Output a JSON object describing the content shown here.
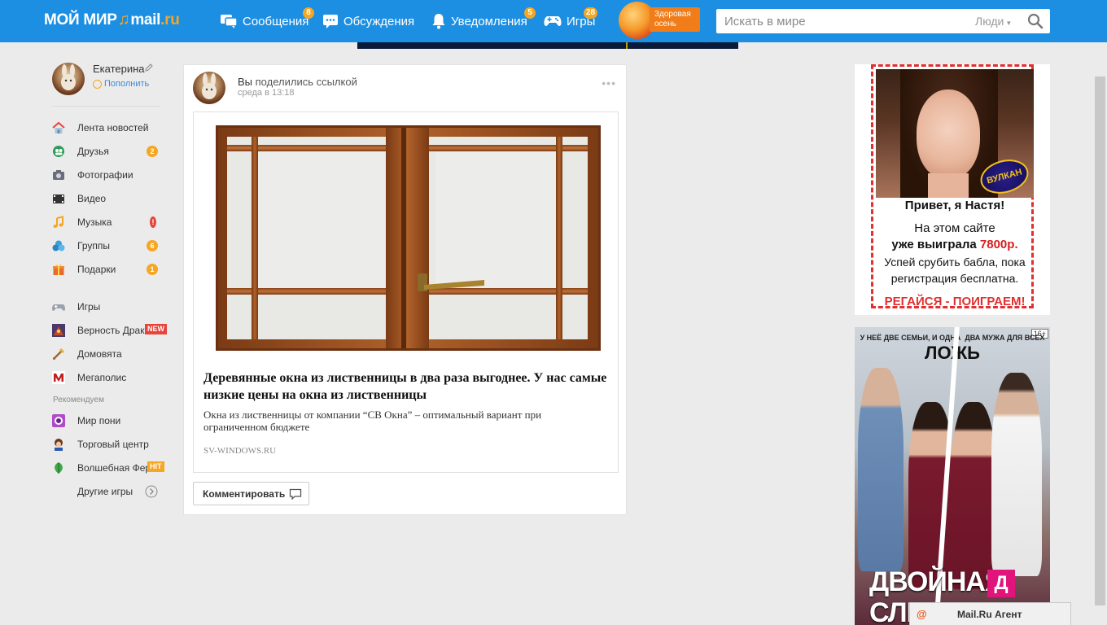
{
  "header": {
    "logo_text": "МОЙ МИР",
    "logo_mail": "mail",
    "logo_ru": ".ru",
    "nav": [
      {
        "label": "Сообщения",
        "badge": "8",
        "icon": "messages-icon"
      },
      {
        "label": "Обсуждения",
        "badge": "",
        "icon": "discussions-icon"
      },
      {
        "label": "Уведомления",
        "badge": "5",
        "icon": "bell-icon"
      },
      {
        "label": "Игры",
        "badge": "28",
        "icon": "gamepad-icon"
      }
    ],
    "promo_label": "Здоровая осень",
    "search_placeholder": "Искать в мире",
    "search_scope": "Люди"
  },
  "sidebar": {
    "profile_name": "Екатерина",
    "profile_action": "Пополнить",
    "items": [
      {
        "label": "Лента новостей",
        "icon": "home-icon",
        "badge": ""
      },
      {
        "label": "Друзья",
        "icon": "friends-icon",
        "badge": "2"
      },
      {
        "label": "Фотографии",
        "icon": "camera-icon",
        "badge": ""
      },
      {
        "label": "Видео",
        "icon": "video-icon",
        "badge": ""
      },
      {
        "label": "Музыка",
        "icon": "music-icon",
        "badge": "!"
      },
      {
        "label": "Группы",
        "icon": "groups-icon",
        "badge": "6"
      },
      {
        "label": "Подарки",
        "icon": "gift-icon",
        "badge": "1"
      }
    ],
    "games": [
      {
        "label": "Игры",
        "icon": "games-icon"
      },
      {
        "label": "Верность Драконов",
        "icon": "dragon-game-icon",
        "tag": "NEW"
      },
      {
        "label": "Домовята",
        "icon": "domovyata-game-icon"
      },
      {
        "label": "Мегаполис",
        "icon": "megapolis-game-icon"
      }
    ],
    "recommended_caption": "Рекомендуем",
    "recommended": [
      {
        "label": "Мир пони",
        "icon": "pony-game-icon"
      },
      {
        "label": "Торговый центр",
        "icon": "mall-game-icon"
      },
      {
        "label": "Волшебная Ферма",
        "icon": "farm-game-icon",
        "tag": "HIT"
      },
      {
        "label": "Другие игры",
        "icon": ""
      }
    ]
  },
  "post": {
    "author": "Вы",
    "action": "поделились ссылкой",
    "time": "среда в 13:18",
    "menu": "•••",
    "link_title": "Деревянные окна из лиственницы в два раза выгоднее. У нас самые низкие цены на окна из лиственницы",
    "link_desc": "Окна из лиственницы от компании “СВ Окна” – оптимальный вариант при ограниченном бюджете",
    "link_domain": "SV-WINDOWS.RU",
    "comment_button": "Комментировать"
  },
  "ad1": {
    "logo": "ВУЛКАН",
    "greeting": "Привет, я Настя!",
    "line1": "На этом сайте",
    "line2_prefix": "уже выиграла ",
    "line2_amount": "7800р.",
    "line3": "Успей срубить бабла, пока",
    "line4": "регистрация бесплатна.",
    "cta": "РЕГАЙСЯ - ПОИГРАЕМ!"
  },
  "ad2": {
    "age": "16+",
    "top_left": "У НЕЁ ДВЕ СЕМЬИ, И ОДНА",
    "top_right": "ДВА МУЖА ДЛЯ ВСЕХ",
    "lie": "ЛОЖЬ",
    "title1": "ДВОЙНАЯ",
    "title2": "СЛЕ",
    "channel": "Д"
  },
  "agent": {
    "label": "Mail.Ru Агент"
  },
  "colors": {
    "topbar": "#1c8fe2",
    "badge": "#f5a623",
    "accent_red": "#e03030",
    "link": "#3d8ad6"
  }
}
